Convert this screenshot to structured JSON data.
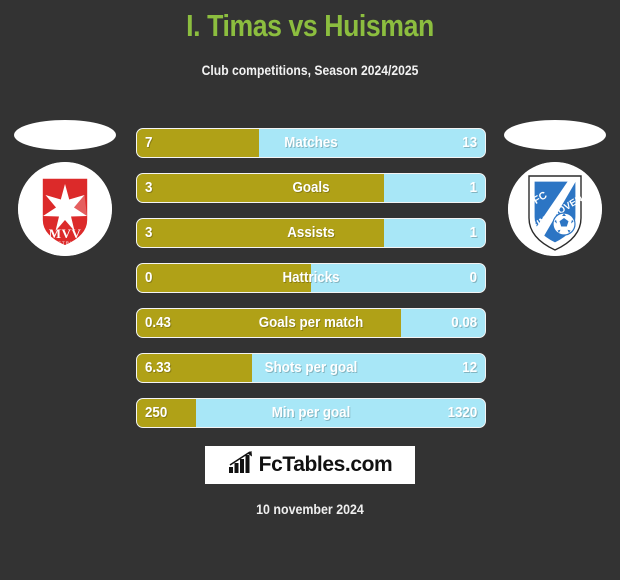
{
  "header": {
    "title": "I. Timas vs Huisman",
    "subtitle": "Club competitions, Season 2024/2025",
    "title_color": "#8CBE3F",
    "background_color": "#333333"
  },
  "home": {
    "club_name": "MVV",
    "club_subtitle": "MAASTRICHT",
    "crest_icon": "mvv-maastricht-crest-icon",
    "photo_icon": "player-photo-placeholder",
    "color": "#B0A117"
  },
  "away": {
    "club_name": "FC EINDHOVEN",
    "crest_icon": "fc-eindhoven-crest-icon",
    "photo_icon": "player-photo-placeholder",
    "color": "#A8E7F7"
  },
  "footer": {
    "brand": "FcTables.com",
    "brand_icon": "bar-chart-growth-icon",
    "date": "10 november 2024"
  },
  "chart_data": {
    "type": "bar",
    "title": "I. Timas vs Huisman",
    "subtitle": "Club competitions, Season 2024/2025",
    "orientation": "horizontal-diverging",
    "legend": [
      "I. Timas",
      "Huisman"
    ],
    "series": [
      {
        "name": "I. Timas",
        "color": "#B0A117",
        "values": [
          7,
          3,
          3,
          0,
          0.43,
          6.33,
          250
        ]
      },
      {
        "name": "Huisman",
        "color": "#A8E7F7",
        "values": [
          13,
          1,
          1,
          0,
          0.08,
          12,
          1320
        ]
      }
    ],
    "categories": [
      "Matches",
      "Goals",
      "Assists",
      "Hattricks",
      "Goals per match",
      "Shots per goal",
      "Min per goal"
    ],
    "rows": [
      {
        "label": "Matches",
        "home": "7",
        "away": "13",
        "home_pct": 35
      },
      {
        "label": "Goals",
        "home": "3",
        "away": "1",
        "home_pct": 71
      },
      {
        "label": "Assists",
        "home": "3",
        "away": "1",
        "home_pct": 71
      },
      {
        "label": "Hattricks",
        "home": "0",
        "away": "0",
        "home_pct": 50
      },
      {
        "label": "Goals per match",
        "home": "0.43",
        "away": "0.08",
        "home_pct": 76
      },
      {
        "label": "Shots per goal",
        "home": "6.33",
        "away": "12",
        "home_pct": 33
      },
      {
        "label": "Min per goal",
        "home": "250",
        "away": "1320",
        "home_pct": 17
      }
    ],
    "grid": false,
    "legend_position": "sides"
  }
}
